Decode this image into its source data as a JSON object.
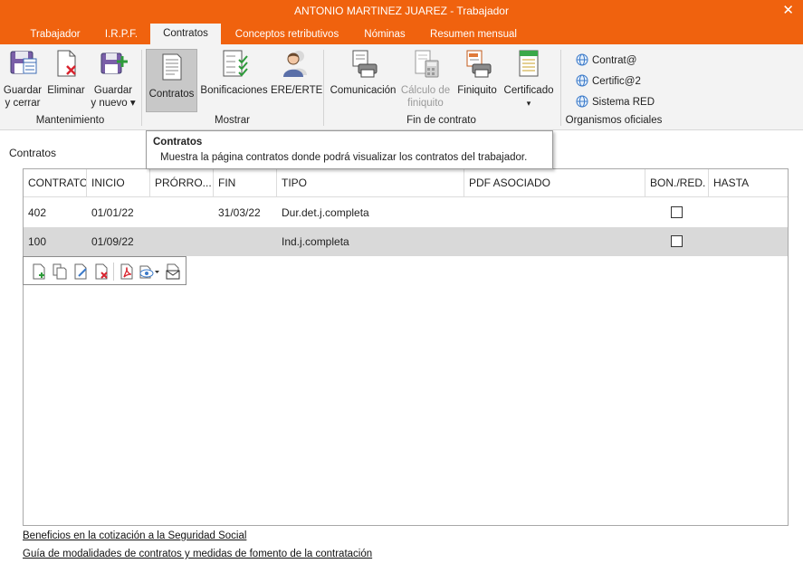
{
  "window": {
    "title": "ANTONIO MARTINEZ JUAREZ - Trabajador",
    "close_glyph": "✕"
  },
  "tabs": [
    {
      "label": "Trabajador"
    },
    {
      "label": "I.R.P.F."
    },
    {
      "label": "Contratos"
    },
    {
      "label": "Conceptos retributivos"
    },
    {
      "label": "Nóminas"
    },
    {
      "label": "Resumen mensual"
    }
  ],
  "ribbon": {
    "mantenimiento": {
      "label": "Mantenimiento",
      "guardar_cerrar": [
        "Guardar",
        "y cerrar"
      ],
      "eliminar": "Eliminar",
      "guardar_nuevo": [
        "Guardar",
        "y nuevo ▾"
      ]
    },
    "mostrar": {
      "label": "Mostrar",
      "contratos": "Contratos",
      "bonificaciones": "Bonificaciones",
      "ere": "ERE/ERTE"
    },
    "fin": {
      "label": "Fin de contrato",
      "comunicacion": "Comunicación",
      "calculo": [
        "Cálculo de",
        "finiquito"
      ],
      "finiquito": "Finiquito",
      "certificado": "Certificado",
      "certificado_arrow": "▾"
    },
    "organismos": {
      "label": "Organismos oficiales",
      "items": [
        "Contrat@",
        "Certific@2",
        "Sistema RED"
      ]
    }
  },
  "tooltip": {
    "title": "Contratos",
    "body": "Muestra la página contratos donde podrá visualizar los contratos del trabajador."
  },
  "section_label": "Contratos",
  "table": {
    "columns": [
      "CONTRATO",
      "INICIO",
      "PRÓRRO...",
      "FIN",
      "TIPO",
      "PDF ASOCIADO",
      "BON./RED.",
      "HASTA"
    ],
    "rows": [
      {
        "contrato": "402",
        "inicio": "01/01/22",
        "prorroga": "",
        "fin": "31/03/22",
        "tipo": "Dur.det.j.completa",
        "pdf": "",
        "bon": false,
        "hasta": ""
      },
      {
        "contrato": "100",
        "inicio": "01/09/22",
        "prorroga": "",
        "fin": "",
        "tipo": "Ind.j.completa",
        "pdf": "",
        "bon": false,
        "hasta": ""
      }
    ]
  },
  "links": [
    "Beneficios en la cotización a la Seguridad Social",
    "Guía de modalidades de contratos y medidas de fomento de la contratación"
  ],
  "colors": {
    "accent": "#f0620e",
    "ribbon_bg": "#f3f3f3",
    "selected_row": "#d9d9d9"
  }
}
